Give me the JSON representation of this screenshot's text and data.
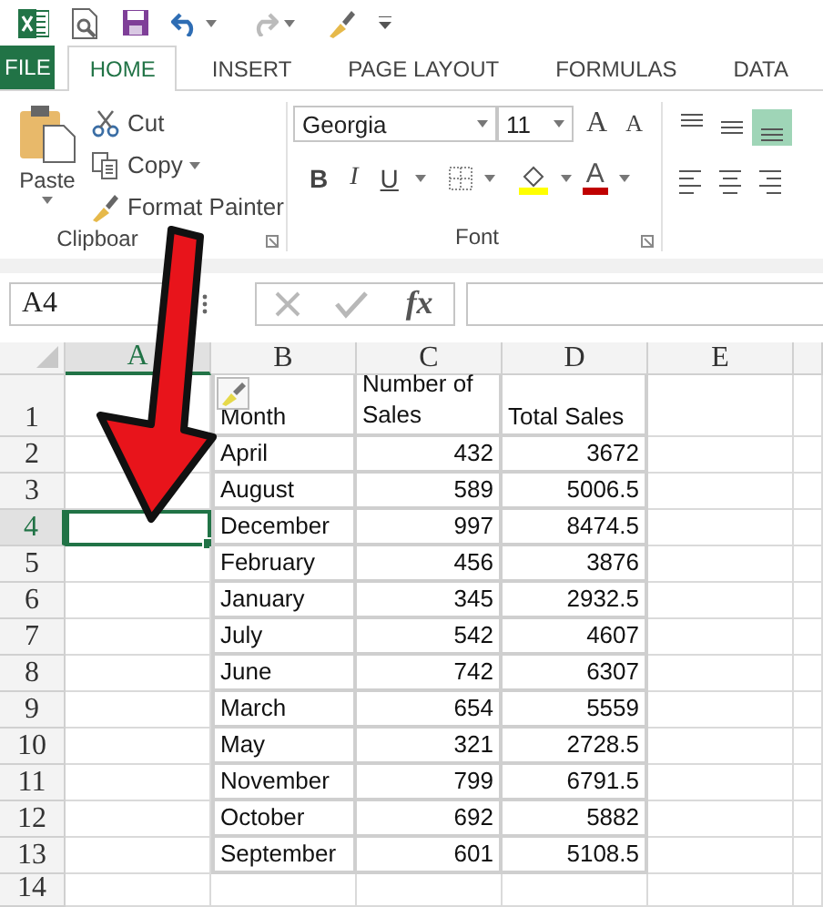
{
  "tabs": [
    {
      "label": "FILE",
      "kind": "file",
      "selected": false
    },
    {
      "label": "HOME",
      "kind": "tab",
      "selected": true
    },
    {
      "label": "INSERT",
      "kind": "tab",
      "selected": false
    },
    {
      "label": "PAGE LAYOUT",
      "kind": "tab",
      "selected": false
    },
    {
      "label": "FORMULAS",
      "kind": "tab",
      "selected": false
    },
    {
      "label": "DATA",
      "kind": "tab",
      "selected": false
    }
  ],
  "clipboard": {
    "paste": "Paste",
    "cut": "Cut",
    "copy": "Copy",
    "format_painter": "Format Painter",
    "label": "Clipboar"
  },
  "font": {
    "name": "Georgia",
    "size": "11",
    "grow": "A",
    "shrink": "A",
    "bold": "B",
    "italic": "I",
    "underline": "U",
    "font_color": "A",
    "label": "Font"
  },
  "alignment_buttons": [
    {
      "kind": "top",
      "selected": false
    },
    {
      "kind": "middle",
      "selected": false
    },
    {
      "kind": "bottom",
      "selected": true
    },
    {
      "kind": "left",
      "selected": false
    },
    {
      "kind": "center",
      "selected": false
    },
    {
      "kind": "right",
      "selected": false
    }
  ],
  "formula_bar": {
    "name_box": "A4",
    "function": "fx"
  },
  "sheet": {
    "columns": [
      {
        "label": "A",
        "selected": true
      },
      {
        "label": "B",
        "selected": false
      },
      {
        "label": "C",
        "selected": false
      },
      {
        "label": "D",
        "selected": false
      },
      {
        "label": "E",
        "selected": false
      }
    ],
    "rows": [
      {
        "number": "1",
        "selected": false,
        "kind": "header",
        "cells": [
          "",
          "Month",
          "Number of Sales",
          "Total Sales"
        ]
      },
      {
        "number": "2",
        "selected": false,
        "cells": [
          "",
          "April",
          "432",
          "3672"
        ]
      },
      {
        "number": "3",
        "selected": false,
        "cells": [
          "",
          "August",
          "589",
          "5006.5"
        ]
      },
      {
        "number": "4",
        "selected": true,
        "cells": [
          "",
          "December",
          "997",
          "8474.5"
        ]
      },
      {
        "number": "5",
        "selected": false,
        "cells": [
          "",
          "February",
          "456",
          "3876"
        ]
      },
      {
        "number": "6",
        "selected": false,
        "cells": [
          "",
          "January",
          "345",
          "2932.5"
        ]
      },
      {
        "number": "7",
        "selected": false,
        "cells": [
          "",
          "July",
          "542",
          "4607"
        ]
      },
      {
        "number": "8",
        "selected": false,
        "cells": [
          "",
          "June",
          "742",
          "6307"
        ]
      },
      {
        "number": "9",
        "selected": false,
        "cells": [
          "",
          "March",
          "654",
          "5559"
        ]
      },
      {
        "number": "10",
        "selected": false,
        "cells": [
          "",
          "May",
          "321",
          "2728.5"
        ]
      },
      {
        "number": "11",
        "selected": false,
        "cells": [
          "",
          "November",
          "799",
          "6791.5"
        ]
      },
      {
        "number": "12",
        "selected": false,
        "cells": [
          "",
          "October",
          "692",
          "5882"
        ]
      },
      {
        "number": "13",
        "selected": false,
        "cells": [
          "",
          "September",
          "601",
          "5108.5"
        ]
      },
      {
        "number": "14",
        "selected": false,
        "cells": []
      }
    ]
  }
}
